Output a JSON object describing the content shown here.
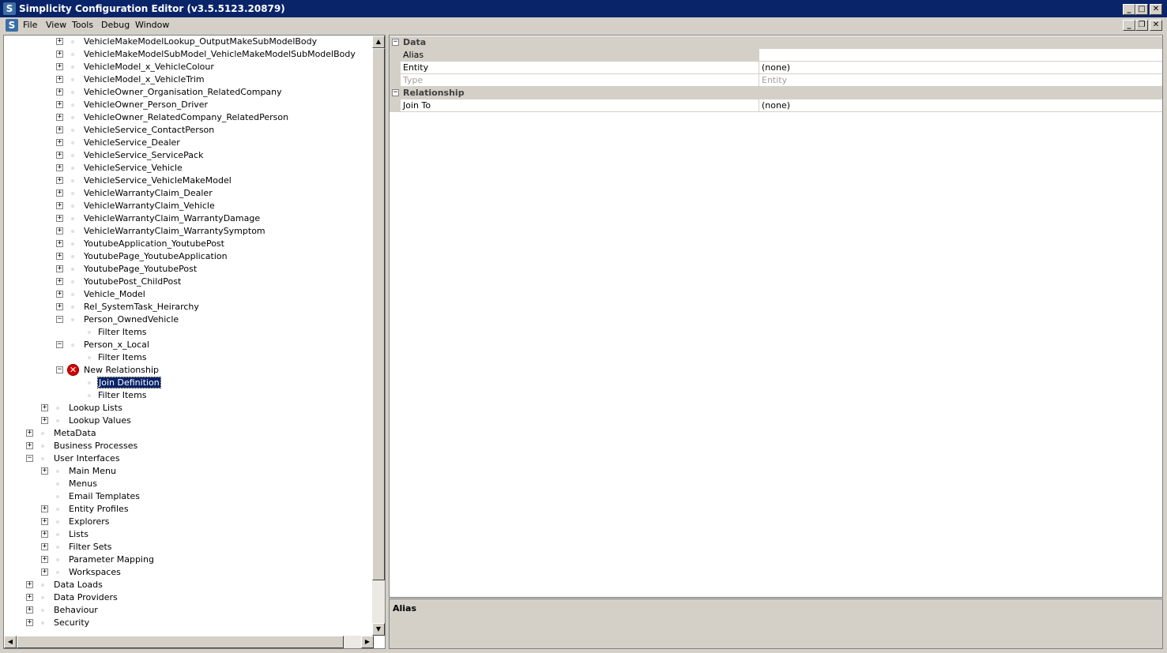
{
  "window": {
    "title": "Simplicity Configuration Editor (v3.5.5123.20879)",
    "icon_letter": "S"
  },
  "title_buttons": {
    "minimize": "_",
    "maximize": "□",
    "close": "✕"
  },
  "mdi_buttons": {
    "minimize": "_",
    "restore": "❐",
    "close": "✕"
  },
  "menu": [
    "File",
    "View",
    "Tools",
    "Debug",
    "Window"
  ],
  "tree": [
    {
      "label": "VehicleMakeModelLookup_OutputMakeSubModelBody",
      "toggle": "+",
      "level": 3
    },
    {
      "label": "VehicleMakeModelSubModel_VehicleMakeModelSubModelBody",
      "toggle": "+",
      "level": 3
    },
    {
      "label": "VehicleModel_x_VehicleColour",
      "toggle": "+",
      "level": 3
    },
    {
      "label": "VehicleModel_x_VehicleTrim",
      "toggle": "+",
      "level": 3
    },
    {
      "label": "VehicleOwner_Organisation_RelatedCompany",
      "toggle": "+",
      "level": 3
    },
    {
      "label": "VehicleOwner_Person_Driver",
      "toggle": "+",
      "level": 3
    },
    {
      "label": "VehicleOwner_RelatedCompany_RelatedPerson",
      "toggle": "+",
      "level": 3
    },
    {
      "label": "VehicleService_ContactPerson",
      "toggle": "+",
      "level": 3
    },
    {
      "label": "VehicleService_Dealer",
      "toggle": "+",
      "level": 3
    },
    {
      "label": "VehicleService_ServicePack",
      "toggle": "+",
      "level": 3
    },
    {
      "label": "VehicleService_Vehicle",
      "toggle": "+",
      "level": 3
    },
    {
      "label": "VehicleService_VehicleMakeModel",
      "toggle": "+",
      "level": 3
    },
    {
      "label": "VehicleWarrantyClaim_Dealer",
      "toggle": "+",
      "level": 3
    },
    {
      "label": "VehicleWarrantyClaim_Vehicle",
      "toggle": "+",
      "level": 3
    },
    {
      "label": "VehicleWarrantyClaim_WarrantyDamage",
      "toggle": "+",
      "level": 3
    },
    {
      "label": "VehicleWarrantyClaim_WarrantySymptom",
      "toggle": "+",
      "level": 3
    },
    {
      "label": "YoutubeApplication_YoutubePost",
      "toggle": "+",
      "level": 3
    },
    {
      "label": "YoutubePage_YoutubeApplication",
      "toggle": "+",
      "level": 3
    },
    {
      "label": "YoutubePage_YoutubePost",
      "toggle": "+",
      "level": 3
    },
    {
      "label": "YoutubePost_ChildPost",
      "toggle": "+",
      "level": 3
    },
    {
      "label": "Vehicle_Model",
      "toggle": "+",
      "level": 3
    },
    {
      "label": "Rel_SystemTask_Heirarchy",
      "toggle": "+",
      "level": 3
    },
    {
      "label": "Person_OwnedVehicle",
      "toggle": "-",
      "level": 3
    },
    {
      "label": "Filter Items",
      "toggle": "",
      "level": 4
    },
    {
      "label": "Person_x_Local",
      "toggle": "-",
      "level": 3
    },
    {
      "label": "Filter Items",
      "toggle": "",
      "level": 4
    },
    {
      "label": "New Relationship",
      "toggle": "-",
      "level": 3,
      "error": true
    },
    {
      "label": "Join Definition",
      "toggle": "",
      "level": 4,
      "selected": true
    },
    {
      "label": "Filter Items",
      "toggle": "",
      "level": 4
    },
    {
      "label": "Lookup Lists",
      "toggle": "+",
      "level": 2
    },
    {
      "label": "Lookup Values",
      "toggle": "+",
      "level": 2
    },
    {
      "label": "MetaData",
      "toggle": "+",
      "level": 1
    },
    {
      "label": "Business Processes",
      "toggle": "+",
      "level": 1
    },
    {
      "label": "User Interfaces",
      "toggle": "-",
      "level": 1
    },
    {
      "label": "Main Menu",
      "toggle": "+",
      "level": 2
    },
    {
      "label": "Menus",
      "toggle": "",
      "level": 2
    },
    {
      "label": "Email Templates",
      "toggle": "",
      "level": 2
    },
    {
      "label": "Entity Profiles",
      "toggle": "+",
      "level": 2
    },
    {
      "label": "Explorers",
      "toggle": "+",
      "level": 2
    },
    {
      "label": "Lists",
      "toggle": "+",
      "level": 2
    },
    {
      "label": "Filter Sets",
      "toggle": "+",
      "level": 2
    },
    {
      "label": "Parameter Mapping",
      "toggle": "+",
      "level": 2
    },
    {
      "label": "Workspaces",
      "toggle": "+",
      "level": 2
    },
    {
      "label": "Data Loads",
      "toggle": "+",
      "level": 1
    },
    {
      "label": "Data Providers",
      "toggle": "+",
      "level": 1
    },
    {
      "label": "Behaviour",
      "toggle": "+",
      "level": 1
    },
    {
      "label": "Security",
      "toggle": "+",
      "level": 1
    }
  ],
  "properties": {
    "categories": [
      {
        "name": "Data",
        "rows": [
          {
            "name": "Alias",
            "value": "",
            "selected": true
          },
          {
            "name": "Entity",
            "value": "(none)"
          },
          {
            "name": "Type",
            "value": "Entity",
            "disabled": true
          }
        ]
      },
      {
        "name": "Relationship",
        "rows": [
          {
            "name": "Join To",
            "value": "(none)"
          }
        ]
      }
    ]
  },
  "description": {
    "title": "Alias"
  },
  "scroll": {
    "up": "▲",
    "down": "▼",
    "left": "◀",
    "right": "▶"
  }
}
